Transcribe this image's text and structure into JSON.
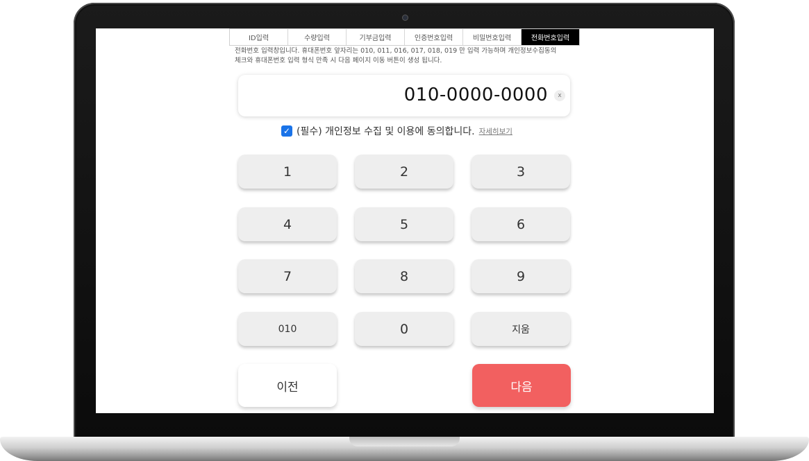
{
  "tabs": [
    {
      "label": "ID입력",
      "active": false
    },
    {
      "label": "수량입력",
      "active": false
    },
    {
      "label": "기부금입력",
      "active": false
    },
    {
      "label": "인증번호입력",
      "active": false
    },
    {
      "label": "비밀번호입력",
      "active": false
    },
    {
      "label": "전화번호입력",
      "active": true
    }
  ],
  "description": {
    "line1": "전화번호 입력창입니다. 휴대폰번호 앞자리는 010, 011, 016, 017, 018, 019 만 입력 가능하며 개인정보수집동의",
    "line2": "체크와 휴대폰번호 입력 형식 만족 시 다음 페이지 이동 버튼이 생성 됩니다."
  },
  "phone_display": {
    "value": "010-0000-0000",
    "clear_label": "x"
  },
  "consent": {
    "checked": true,
    "label": "(필수) 개인정보 수집 및 이용에 동의합니다.",
    "detail_link": "자세히보기"
  },
  "keypad": {
    "keys": [
      "1",
      "2",
      "3",
      "4",
      "5",
      "6",
      "7",
      "8",
      "9",
      "010",
      "0",
      "지움"
    ]
  },
  "navigation": {
    "prev_label": "이전",
    "next_label": "다음"
  },
  "colors": {
    "active_tab": "#000000",
    "next_button": "#f26060",
    "checkbox": "#1a73e8"
  }
}
